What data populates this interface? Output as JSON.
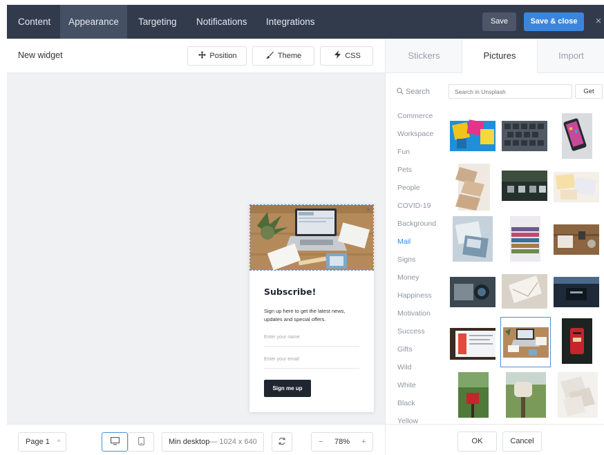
{
  "topbar": {
    "tabs": [
      "Content",
      "Appearance",
      "Targeting",
      "Notifications",
      "Integrations"
    ],
    "active_tab": "Appearance",
    "save_label": "Save",
    "save_close_label": "Save & close",
    "close_glyph": "×"
  },
  "editor": {
    "title": "New widget",
    "position_label": "Position",
    "theme_label": "Theme",
    "css_label": "CSS"
  },
  "widget": {
    "close_glyph": "×",
    "title": "Subscribe!",
    "text": "Sign up here to get the latest news, updates and special offers.",
    "name_placeholder": "Enter your name",
    "email_placeholder": "Enter your email",
    "button_label": "Sign me up"
  },
  "bottombar": {
    "page_label": "Page 1",
    "page_chevron": "^",
    "viewport_label": "Min desktop",
    "viewport_size": "— 1024 x 640",
    "viewport_chevron": "^",
    "zoom_minus": "−",
    "zoom_value": "78%",
    "zoom_plus": "+"
  },
  "rpanel": {
    "tabs": [
      "Stickers",
      "Pictures",
      "Import"
    ],
    "active_tab": "Pictures",
    "search_label": "Search",
    "search_placeholder": "Search in Unsplash",
    "get_label": "Get",
    "categories": [
      "Commerce",
      "Workspace",
      "Fun",
      "Pets",
      "People",
      "COVID-19",
      "Background",
      "Mail",
      "Signs",
      "Money",
      "Happiness",
      "Motivation",
      "Success",
      "Gifts",
      "Wild",
      "White",
      "Black",
      "Yellow"
    ],
    "active_category": "Mail",
    "ok_label": "OK",
    "cancel_label": "Cancel"
  },
  "colors": {
    "topbar": "#323b4c",
    "active_tab": "#465064",
    "accent": "#3b86dc",
    "button_dark": "#1f2630"
  }
}
